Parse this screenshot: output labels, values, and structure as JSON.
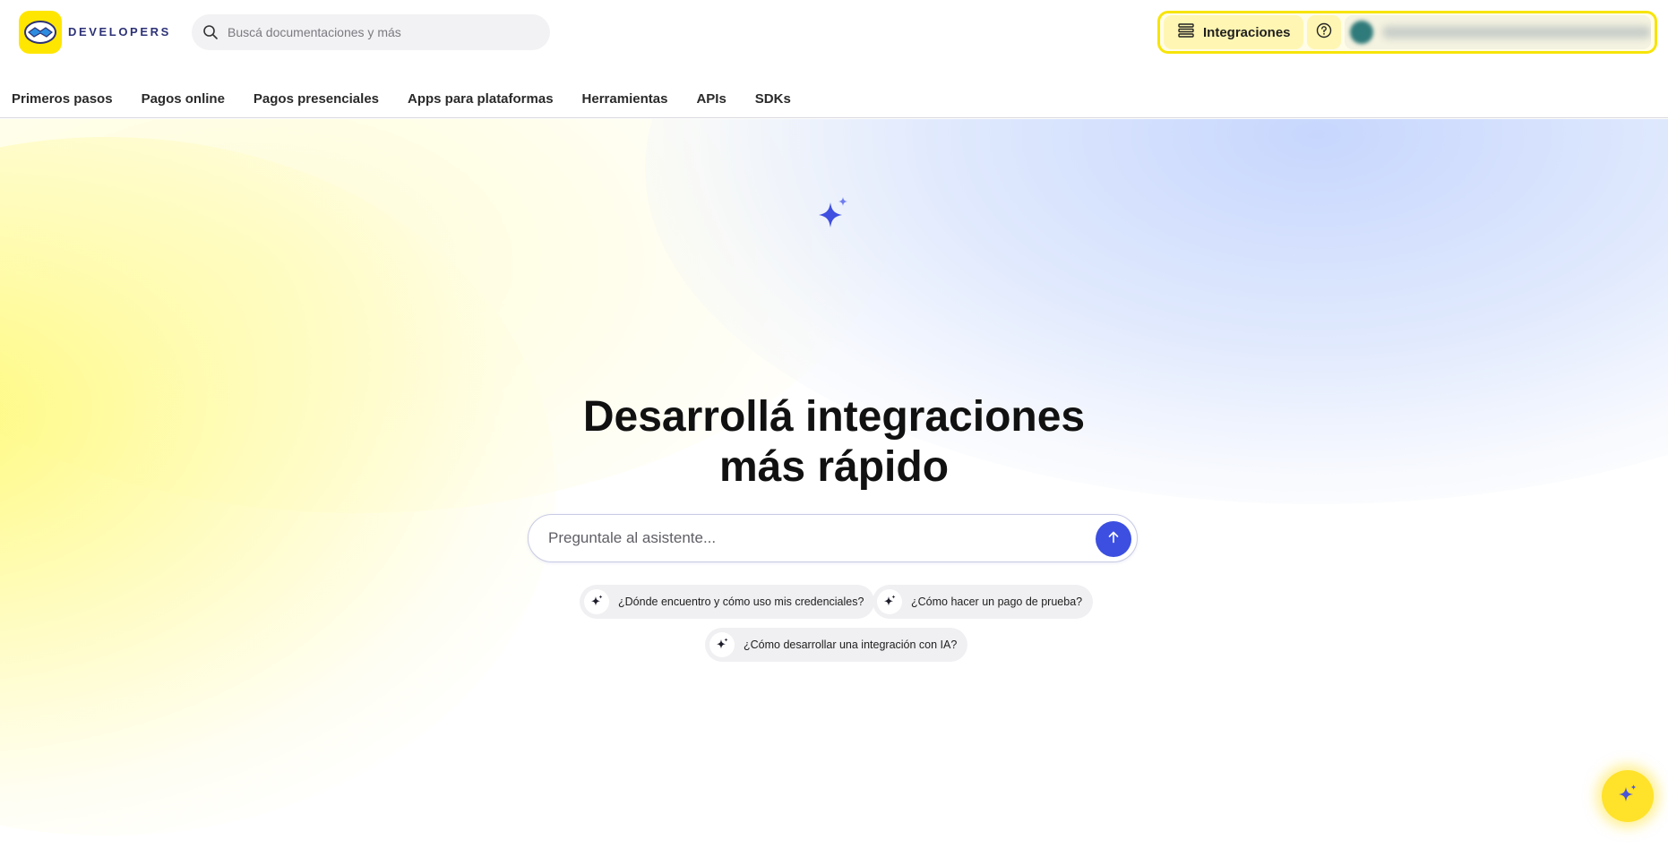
{
  "header": {
    "brand": "DEVELOPERS",
    "search_placeholder": "Buscá documentaciones y más",
    "integrations_label": "Integraciones",
    "logo_icon": "mercadopago-handshake-icon",
    "help_icon": "question-circle-icon"
  },
  "nav": {
    "items": [
      {
        "label": "Primeros pasos"
      },
      {
        "label": "Pagos online"
      },
      {
        "label": "Pagos presenciales"
      },
      {
        "label": "Apps para plataformas"
      },
      {
        "label": "Herramientas"
      },
      {
        "label": "APIs"
      },
      {
        "label": "SDKs"
      }
    ]
  },
  "hero": {
    "title_line1": "Desarrollá integraciones",
    "title_line2": "más rápido",
    "ask_placeholder": "Preguntale al asistente...",
    "suggestions": [
      {
        "label": "¿Dónde encuentro y cómo uso mis credenciales?"
      },
      {
        "label": "¿Cómo hacer un pago de prueba?"
      },
      {
        "label": "¿Cómo desarrollar una integración con IA?"
      }
    ]
  },
  "colors": {
    "accent_blue": "#3c4fe0",
    "brand_yellow": "#ffe600",
    "brand_navy": "#2d3277"
  }
}
